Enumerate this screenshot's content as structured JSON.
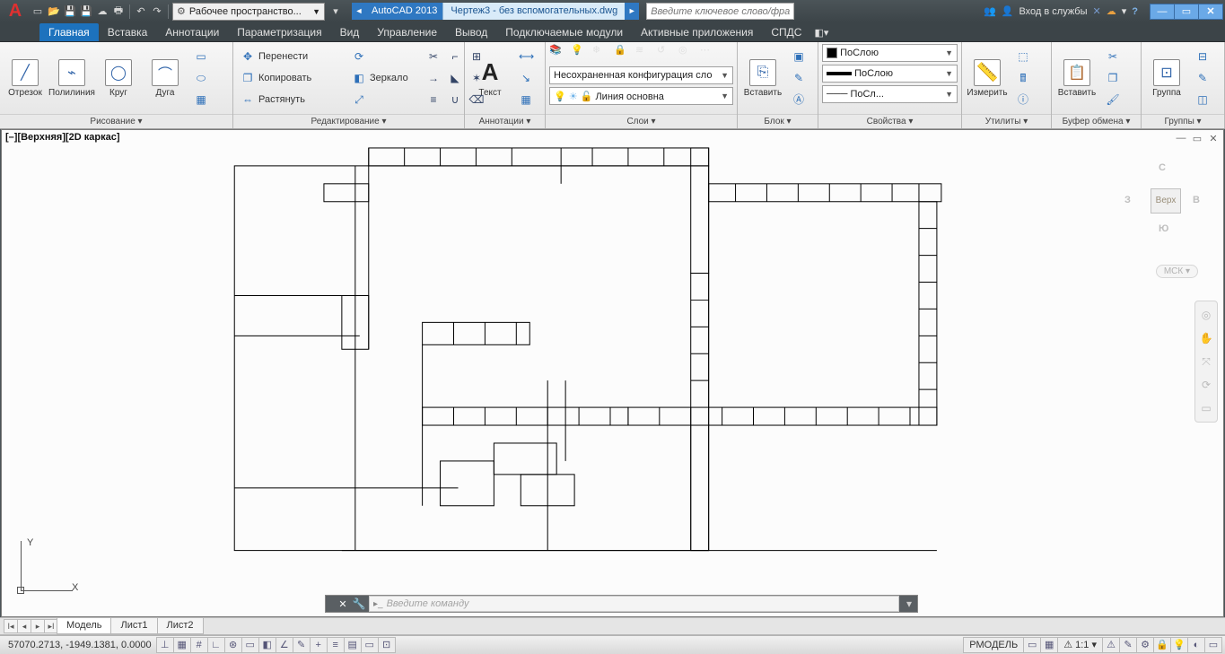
{
  "title": {
    "app": "AutoCAD 2013",
    "doc": "Чертеж3 - без вспомогательных.dwg"
  },
  "workspace_combo": "Рабочее пространство...",
  "search_placeholder": "Введите ключевое слово/фразу",
  "signin": "Вход в службы",
  "tabs": {
    "items": [
      "Главная",
      "Вставка",
      "Аннотации",
      "Параметризация",
      "Вид",
      "Управление",
      "Вывод",
      "Подключаемые модули",
      "Активные приложения",
      "СПДС"
    ],
    "active": 0
  },
  "ribbon": {
    "draw": {
      "title": "Рисование ▾",
      "line": "Отрезок",
      "polyline": "Полилиния",
      "circle": "Круг",
      "arc": "Дуга"
    },
    "modify": {
      "title": "Редактирование ▾",
      "move": "Перенести",
      "copy": "Копировать",
      "stretch": "Растянуть",
      "rotate": "",
      "mirror": "Зеркало"
    },
    "annot": {
      "title": "Аннотации ▾",
      "text": "Текст"
    },
    "layers": {
      "title": "Слои ▾",
      "combo": "Несохраненная конфигурация сло",
      "current": "Линия основна"
    },
    "block": {
      "title": "Блок ▾",
      "insert": "Вставить"
    },
    "props": {
      "title": "Свойства ▾",
      "bylayer1": "ПоСлою",
      "bylayer2": "ПоСлою",
      "bylayer3": "ПоСл..."
    },
    "utils": {
      "title": "Утилиты ▾",
      "measure": "Измерить"
    },
    "clip": {
      "title": "Буфер обмена ▾",
      "paste": "Вставить"
    },
    "groups": {
      "title": "Группы ▾",
      "group": "Группа"
    }
  },
  "viewport": {
    "label": "[–][Верхняя][2D каркас]"
  },
  "viewcube": {
    "n": "С",
    "s": "Ю",
    "e": "В",
    "w": "З",
    "face": "Верх",
    "wcs": "МСК ▾"
  },
  "ucs": {
    "x": "X",
    "y": "Y"
  },
  "cmd": {
    "placeholder": "Введите команду"
  },
  "model_tabs": {
    "items": [
      "Модель",
      "Лист1",
      "Лист2"
    ],
    "active": 0
  },
  "status": {
    "coords": "57070.2713, -1949.1381, 0.0000",
    "model": "РМОДЕЛЬ",
    "scale": "1:1 ▾"
  }
}
